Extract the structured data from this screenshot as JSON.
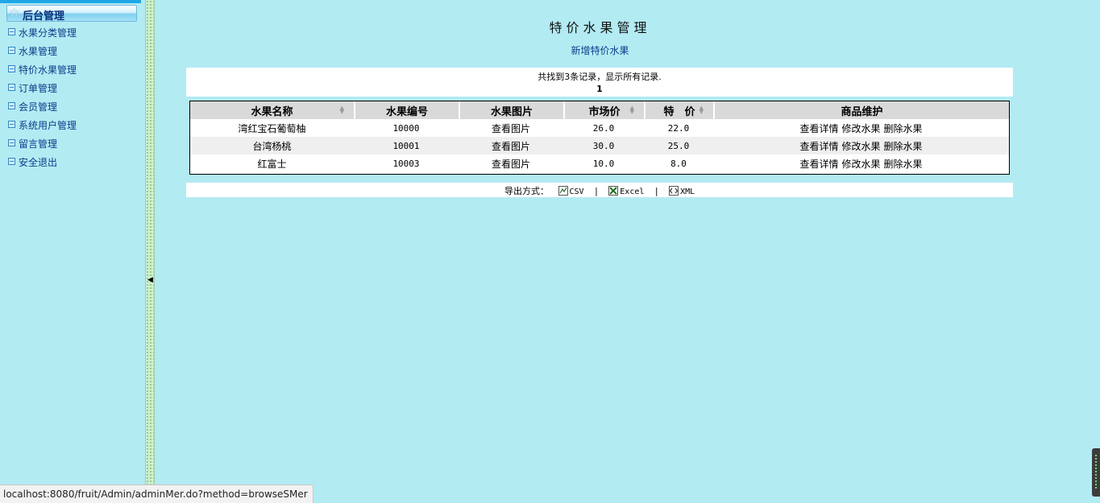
{
  "sidebar": {
    "header": "后台管理",
    "items": [
      {
        "label": "水果分类管理"
      },
      {
        "label": "水果管理"
      },
      {
        "label": "特价水果管理"
      },
      {
        "label": "订单管理"
      },
      {
        "label": "会员管理"
      },
      {
        "label": "系统用户管理"
      },
      {
        "label": "留言管理"
      },
      {
        "label": "安全退出"
      }
    ]
  },
  "main": {
    "title": "特价水果管理",
    "add_link": "新增特价水果",
    "found_text": "共找到3条记录，显示所有记录.",
    "page_number": "1",
    "table": {
      "headers": [
        "水果名称",
        "水果编号",
        "水果图片",
        "市场价",
        "特　价",
        "商品维护"
      ],
      "rows": [
        {
          "name": "湾红宝石葡萄柚",
          "code": "10000",
          "image": "查看图片",
          "market_price": "26.0",
          "special_price": "22.0"
        },
        {
          "name": "台湾杨桃",
          "code": "10001",
          "image": "查看图片",
          "market_price": "30.0",
          "special_price": "25.0"
        },
        {
          "name": "红富士",
          "code": "10003",
          "image": "查看图片",
          "market_price": "10.0",
          "special_price": "8.0"
        }
      ],
      "actions": [
        "查看详情",
        "修改水果",
        "删除水果"
      ]
    },
    "export": {
      "label": "导出方式：",
      "options": [
        "CSV",
        "Excel",
        "XML"
      ],
      "separator": "|"
    }
  },
  "status_bar": {
    "url": "localhost:8080/fruit/Admin/adminMer.do?method=browseSMer"
  },
  "icons": {
    "menu_header": "star-icon",
    "menu_item": "square-bullet-icon",
    "splitter": "collapse-arrow-icon"
  },
  "colors": {
    "background": "#b3ebf3",
    "link": "#0b3d8a",
    "header_bg": "#d9d9d9"
  }
}
